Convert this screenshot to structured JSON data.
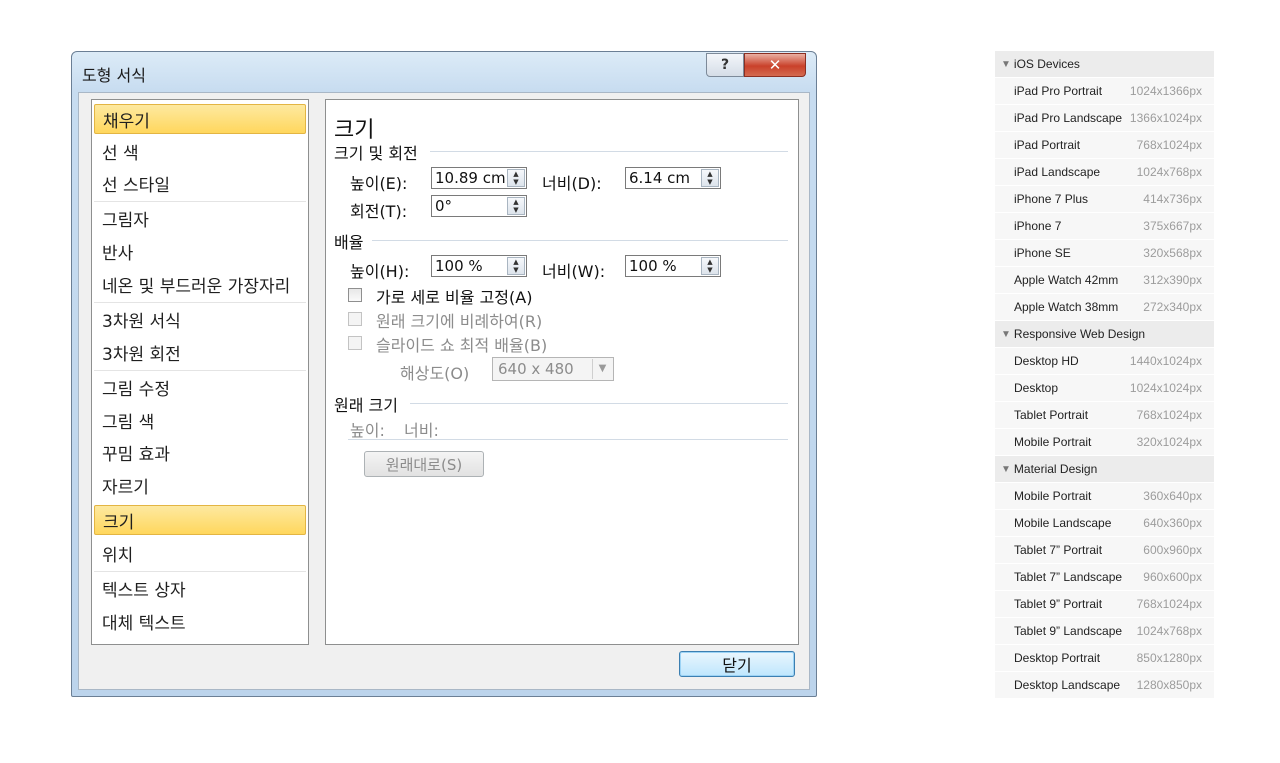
{
  "dialog": {
    "title": "도형 서식",
    "help_label": "?",
    "close_label": "✕",
    "categories": [
      {
        "label": "채우기",
        "selected": true
      },
      {
        "label": "선 색"
      },
      {
        "label": "선 스타일"
      },
      {
        "label": "그림자"
      },
      {
        "label": "반사"
      },
      {
        "label": "네온 및 부드러운 가장자리"
      },
      {
        "label": "3차원 서식"
      },
      {
        "label": "3차원 회전"
      },
      {
        "label": "그림 수정"
      },
      {
        "label": "그림 색"
      },
      {
        "label": "꾸밈 효과"
      },
      {
        "label": "자르기"
      },
      {
        "label": "크기",
        "selected": true
      },
      {
        "label": "위치"
      },
      {
        "label": "텍스트 상자"
      },
      {
        "label": "대체 텍스트"
      }
    ],
    "panel": {
      "title": "크기",
      "size_section": "크기 및 회전",
      "height_label": "높이(E):",
      "height_value": "10.89 cm",
      "width_label": "너비(D):",
      "width_value": "6.14 cm",
      "rotation_label": "회전(T):",
      "rotation_value": "0°",
      "scale_section": "배율",
      "scale_height_label": "높이(H):",
      "scale_height_value": "100 %",
      "scale_width_label": "너비(W):",
      "scale_width_value": "100 %",
      "lock_aspect_label": "가로 세로 비율 고정(A)",
      "relative_label": "원래 크기에 비례하여(R)",
      "slideshow_label": "슬라이드 쇼 최적 배율(B)",
      "resolution_label": "해상도(O)",
      "resolution_value": "640 x 480",
      "original_section": "원래 크기",
      "original_height_label": "높이:",
      "original_width_label": "너비:",
      "reset_button": "원래대로(S)",
      "close_button": "닫기"
    }
  },
  "devices": {
    "groups": [
      {
        "name": "iOS Devices",
        "items": [
          {
            "name": "iPad Pro Portrait",
            "size": "1024x1366px"
          },
          {
            "name": "iPad Pro Landscape",
            "size": "1366x1024px"
          },
          {
            "name": "iPad Portrait",
            "size": "768x1024px"
          },
          {
            "name": "iPad Landscape",
            "size": "1024x768px"
          },
          {
            "name": "iPhone 7 Plus",
            "size": "414x736px"
          },
          {
            "name": "iPhone 7",
            "size": "375x667px"
          },
          {
            "name": "iPhone SE",
            "size": "320x568px"
          },
          {
            "name": "Apple Watch 42mm",
            "size": "312x390px"
          },
          {
            "name": "Apple Watch 38mm",
            "size": "272x340px"
          }
        ]
      },
      {
        "name": "Responsive Web Design",
        "items": [
          {
            "name": "Desktop HD",
            "size": "1440x1024px"
          },
          {
            "name": "Desktop",
            "size": "1024x1024px"
          },
          {
            "name": "Tablet Portrait",
            "size": "768x1024px"
          },
          {
            "name": "Mobile Portrait",
            "size": "320x1024px"
          }
        ]
      },
      {
        "name": "Material Design",
        "items": [
          {
            "name": "Mobile Portrait",
            "size": "360x640px"
          },
          {
            "name": "Mobile Landscape",
            "size": "640x360px"
          },
          {
            "name": "Tablet 7” Portrait",
            "size": "600x960px"
          },
          {
            "name": "Tablet 7” Landscape",
            "size": "960x600px"
          },
          {
            "name": "Tablet 9” Portrait",
            "size": "768x1024px"
          },
          {
            "name": "Tablet 9” Landscape",
            "size": "1024x768px"
          },
          {
            "name": "Desktop Portrait",
            "size": "850x1280px"
          },
          {
            "name": "Desktop Landscape",
            "size": "1280x850px"
          }
        ]
      }
    ]
  }
}
